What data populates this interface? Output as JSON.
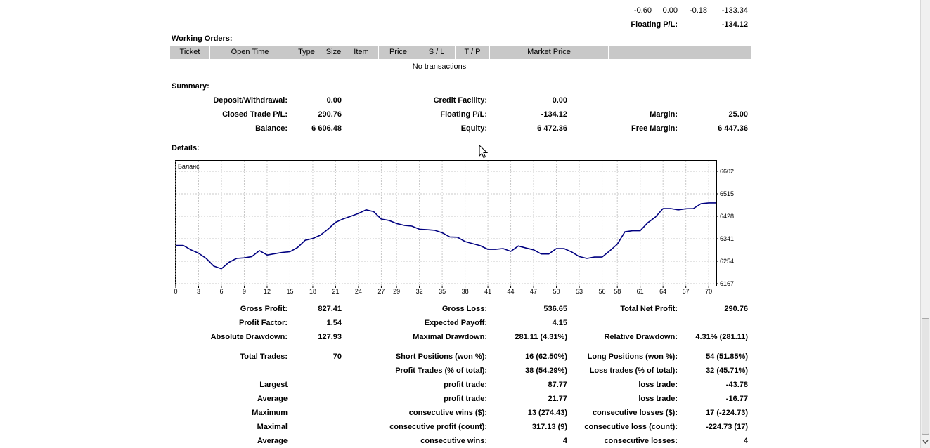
{
  "top_row": {
    "values": [
      "-0.60",
      "0.00",
      "-0.18",
      "-133.34"
    ]
  },
  "floating_top": {
    "label": "Floating P/L:",
    "value": "-134.12"
  },
  "working_orders": {
    "title": "Working Orders:",
    "columns": [
      "Ticket",
      "Open Time",
      "Type",
      "Size",
      "Item",
      "Price",
      "S / L",
      "T / P",
      "Market Price",
      ""
    ],
    "empty_text": "No transactions"
  },
  "summary": {
    "title": "Summary:",
    "deposit": {
      "label": "Deposit/Withdrawal:",
      "value": "0.00"
    },
    "credit": {
      "label": "Credit Facility:",
      "value": "0.00"
    },
    "closed_pl": {
      "label": "Closed Trade P/L:",
      "value": "290.76"
    },
    "floating": {
      "label": "Floating P/L:",
      "value": "-134.12"
    },
    "margin": {
      "label": "Margin:",
      "value": "25.00"
    },
    "balance": {
      "label": "Balance:",
      "value": "6 606.48"
    },
    "equity": {
      "label": "Equity:",
      "value": "6 472.36"
    },
    "free_margin": {
      "label": "Free Margin:",
      "value": "6 447.36"
    }
  },
  "details": {
    "title": "Details:"
  },
  "chart_data": {
    "type": "line",
    "title": "Баланс",
    "xlabel": "",
    "ylabel": "",
    "x_ticks": [
      "0",
      "3",
      "6",
      "9",
      "12",
      "15",
      "18",
      "21",
      "24",
      "27",
      "29",
      "32",
      "35",
      "38",
      "41",
      "44",
      "47",
      "50",
      "53",
      "56",
      "58",
      "61",
      "64",
      "67",
      "70"
    ],
    "y_ticks": [
      "6602",
      "6515",
      "6428",
      "6341",
      "6254",
      "6167"
    ],
    "xlim": [
      0,
      71
    ],
    "ylim": [
      6167,
      6602
    ],
    "grid": true,
    "series": [
      {
        "name": "",
        "color": "#000080",
        "x": [
          0,
          1,
          2,
          3,
          4,
          5,
          6,
          7,
          8,
          9,
          10,
          11,
          12,
          13,
          14,
          15,
          16,
          17,
          18,
          19,
          20,
          21,
          22,
          23,
          24,
          25,
          26,
          27,
          28,
          29,
          30,
          31,
          32,
          33,
          34,
          35,
          36,
          37,
          38,
          39,
          40,
          41,
          42,
          43,
          44,
          45,
          46,
          47,
          48,
          49,
          50,
          51,
          52,
          53,
          54,
          55,
          56,
          57,
          58,
          59,
          60,
          61,
          62,
          63,
          64,
          65,
          66,
          67,
          68,
          69,
          70,
          71
        ],
        "y": [
          6315,
          6315,
          6298,
          6285,
          6265,
          6235,
          6225,
          6250,
          6265,
          6267,
          6272,
          6295,
          6278,
          6283,
          6288,
          6291,
          6307,
          6335,
          6342,
          6355,
          6378,
          6405,
          6418,
          6428,
          6439,
          6453,
          6446,
          6417,
          6412,
          6400,
          6393,
          6390,
          6378,
          6376,
          6374,
          6364,
          6348,
          6347,
          6330,
          6322,
          6314,
          6300,
          6300,
          6303,
          6292,
          6313,
          6305,
          6298,
          6282,
          6282,
          6303,
          6303,
          6290,
          6272,
          6265,
          6270,
          6270,
          6294,
          6320,
          6368,
          6372,
          6372,
          6403,
          6425,
          6458,
          6458,
          6453,
          6457,
          6458,
          6477,
          6480,
          6480
        ]
      }
    ]
  },
  "stats": {
    "gross_profit": {
      "label": "Gross Profit:",
      "value": "827.41"
    },
    "gross_loss": {
      "label": "Gross Loss:",
      "value": "536.65"
    },
    "total_net": {
      "label": "Total Net Profit:",
      "value": "290.76"
    },
    "profit_factor": {
      "label": "Profit Factor:",
      "value": "1.54"
    },
    "expected_payoff": {
      "label": "Expected Payoff:",
      "value": "4.15"
    },
    "abs_dd": {
      "label": "Absolute Drawdown:",
      "value": "127.93"
    },
    "max_dd": {
      "label": "Maximal Drawdown:",
      "value": "281.11 (4.31%)"
    },
    "rel_dd": {
      "label": "Relative Drawdown:",
      "value": "4.31% (281.11)"
    },
    "total_trades": {
      "label": "Total Trades:",
      "value": "70"
    },
    "short_pos": {
      "label": "Short Positions (won %):",
      "value": "16 (62.50%)"
    },
    "long_pos": {
      "label": "Long Positions (won %):",
      "value": "54 (51.85%)"
    },
    "profit_trades": {
      "label": "Profit Trades (% of total):",
      "value": "38 (54.29%)"
    },
    "loss_trades": {
      "label": "Loss trades (% of total):",
      "value": "32 (45.71%)"
    },
    "largest": {
      "label": "Largest",
      "p_label": "profit trade:",
      "p_value": "87.77",
      "l_label": "loss trade:",
      "l_value": "-43.78"
    },
    "average": {
      "label": "Average",
      "p_label": "profit trade:",
      "p_value": "21.77",
      "l_label": "loss trade:",
      "l_value": "-16.77"
    },
    "maximum": {
      "label": "Maximum",
      "p_label": "consecutive wins ($):",
      "p_value": "13 (274.43)",
      "l_label": "consecutive losses ($):",
      "l_value": "17 (-224.73)"
    },
    "maximal": {
      "label": "Maximal",
      "p_label": "consecutive profit (count):",
      "p_value": "317.13 (9)",
      "l_label": "consecutive loss (count):",
      "l_value": "-224.73 (17)"
    },
    "average2": {
      "label": "Average",
      "p_label": "consecutive wins:",
      "p_value": "4",
      "l_label": "consecutive losses:",
      "l_value": "4"
    }
  }
}
